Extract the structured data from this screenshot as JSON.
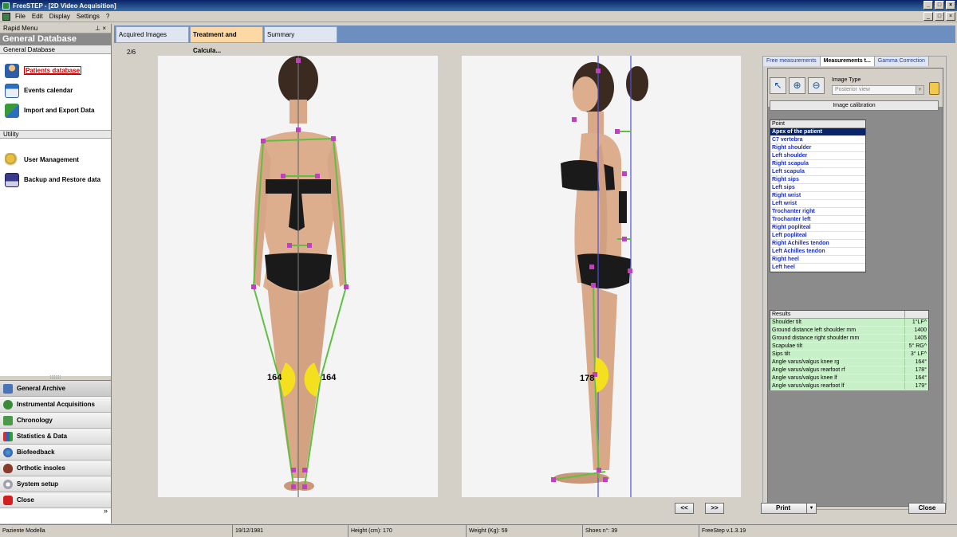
{
  "window": {
    "title": "FreeSTEP - [2D Video Acquisition]"
  },
  "menu": [
    "File",
    "Edit",
    "Display",
    "Settings",
    "?"
  ],
  "left_panel": {
    "header": "Rapid Menu",
    "title": "General Database",
    "section1": "General Database",
    "items1": [
      "Patients database",
      "Events calendar",
      "Import and Export Data"
    ],
    "section2": "Utility",
    "items2": [
      "User Management",
      "Backup and Restore data"
    ],
    "bottom_items": [
      "General Archive",
      "Instrumental Acquisitions",
      "Chronology",
      "Statistics & Data",
      "Biofeedback",
      "Orthotic insoles",
      "System setup",
      "Close"
    ],
    "more": "»"
  },
  "tabs": [
    "Acquired Images",
    "Treatment and Calcula...",
    "Summary"
  ],
  "pager": "2/6",
  "images": {
    "back_angle_right": "164",
    "back_angle_left": "164",
    "side_angle": "178"
  },
  "right_panel": {
    "tabs": [
      "Free measurements",
      "Measurements t...",
      "Gamma Correction"
    ],
    "image_type_label": "Image Type",
    "image_type_value": "Posterior view",
    "calibration_button": "Image calibration",
    "point_header": "Point",
    "points": [
      "Apex of the patient",
      "C7 vertebra",
      "Right shoulder",
      "Left shoulder",
      "Right scapula",
      "Left scapula",
      "Right sips",
      "Left sips",
      "Right wrist",
      "Left wrist",
      "Trochanter right",
      "Trochanter left",
      "Right popliteal",
      "Left popliteal",
      "Right Achilles tendon",
      "Left Achilles tendon",
      "Right heel",
      "Left heel"
    ],
    "results_header": "Results",
    "results": [
      {
        "name": "Shoulder tilt",
        "value": "1°LF^"
      },
      {
        "name": "Ground distance left shoulder mm",
        "value": "1400"
      },
      {
        "name": "Ground distance right shoulder mm",
        "value": "1405"
      },
      {
        "name": "Scapulae tilt",
        "value": "5° RG^"
      },
      {
        "name": "Sips tilt",
        "value": "3° LF^"
      },
      {
        "name": "Angle varus/valgus knee rg",
        "value": "164°"
      },
      {
        "name": "Angle varus/valgus rearfoot rf",
        "value": "178°"
      },
      {
        "name": "Angle varus/valgus knee lf",
        "value": "164°"
      },
      {
        "name": "Angle varus/valgus rearfoot lf",
        "value": "179°"
      }
    ]
  },
  "buttons": {
    "prev": "<<",
    "next": ">>",
    "print": "Print",
    "close": "Close"
  },
  "status": {
    "patient": "Paziente Modella",
    "dob": "19/12/1981",
    "height": "Height (cm): 170",
    "weight": "Weight (Kg): 59",
    "shoes": "Shoes n°: 39",
    "version": "FreeStep v.1.3.19"
  },
  "colors": {
    "marker": "#c040c0",
    "line": "#5fc040",
    "angle": "#f5e020",
    "plumb": "#5050e0"
  }
}
